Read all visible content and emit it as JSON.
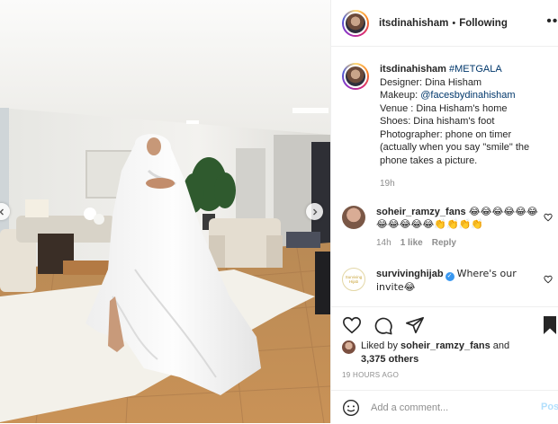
{
  "header": {
    "username": "itsdinahisham",
    "separator": "•",
    "follow_state": "Following"
  },
  "caption": {
    "username": "itsdinahisham",
    "hashtag": "#METGALA",
    "line_designer": "Designer: Dina Hisham",
    "makeup_label": "Makeup: ",
    "makeup_handle": "@facesbydinahisham",
    "line_venue": "Venue : Dina Hisham's home",
    "line_shoes": "Shoes: Dina hisham's foot",
    "line_photographer": "Photographer: phone on timer (actually when you say \"smile\" the phone takes a picture.",
    "time": "19h"
  },
  "comments": [
    {
      "username": "soheir_ramzy_fans",
      "text": "😂😂😂😂😂😂😂😂😂😂😂👏👏👏👏",
      "time": "14h",
      "likes": "1 like",
      "reply": "Reply"
    },
    {
      "username": "survivinghijab",
      "text": "Where's our invite😂",
      "avatar_text": "Surviving Hijab"
    }
  ],
  "likes": {
    "prefix": "Liked by ",
    "user": "soheir_ramzy_fans",
    "middle": " and",
    "others": "3,375 others"
  },
  "post_time": "19 HOURS AGO",
  "add_comment": {
    "placeholder": "Add a comment...",
    "post_label": "Post"
  },
  "colors": {
    "link": "#00376b",
    "muted": "#8e8e8e",
    "verified": "#3897f0",
    "post_disabled": "#b2dffc"
  }
}
